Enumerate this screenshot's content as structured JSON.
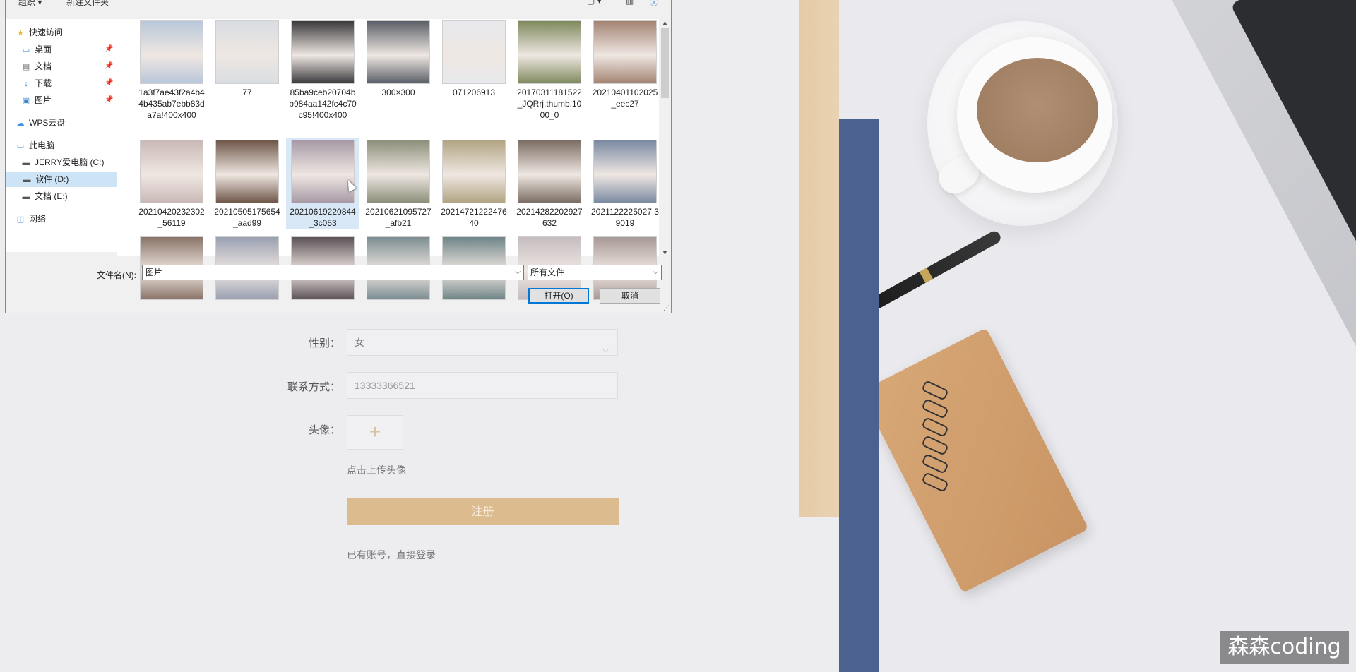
{
  "dialog": {
    "toolbar": {
      "organize": "组织 ▾",
      "new_folder": "新建文件夹"
    },
    "nav": [
      {
        "label": "快速访问",
        "icon": "star-icon",
        "pinned": false
      },
      {
        "label": "桌面",
        "icon": "desktop-icon",
        "pinned": true
      },
      {
        "label": "文档",
        "icon": "document-icon",
        "pinned": true
      },
      {
        "label": "下载",
        "icon": "download-icon",
        "pinned": true
      },
      {
        "label": "图片",
        "icon": "pictures-icon",
        "pinned": true
      },
      {
        "label": "WPS云盘",
        "icon": "cloud-icon",
        "pinned": false
      },
      {
        "label": "此电脑",
        "icon": "computer-icon",
        "pinned": false
      },
      {
        "label": "JERRY爱电脑 (C:)",
        "icon": "drive-icon",
        "pinned": false
      },
      {
        "label": "软件 (D:)",
        "icon": "drive-icon",
        "pinned": false,
        "selected": true
      },
      {
        "label": "文档 (E:)",
        "icon": "drive-icon",
        "pinned": false
      },
      {
        "label": "网络",
        "icon": "network-icon",
        "pinned": false
      }
    ],
    "files": [
      {
        "name": "1a3f7ae43f2a4b44b435ab7ebb83da7a!400x400",
        "color": "#b9c7d9"
      },
      {
        "name": "77",
        "color": "#d9dde2"
      },
      {
        "name": "85ba9ceb20704bb984aa142fc4c70c95!400x400",
        "color": "#3b3a3d"
      },
      {
        "name": "300×300",
        "color": "#5b5f68"
      },
      {
        "name": "071206913",
        "color": "#e7e9ec"
      },
      {
        "name": "20170311181522_JQRrj.thumb.1000_0",
        "color": "#7f8a5e"
      },
      {
        "name": "20210401102025_eec27",
        "color": "#a38473"
      },
      {
        "name": "20210420232302_56119",
        "color": "#c9b9b7"
      },
      {
        "name": "20210505175654_aad99",
        "color": "#6f5749"
      },
      {
        "name": "20210619220844_3c053",
        "color": "#a79aa6",
        "selected": true
      },
      {
        "name": "20210621095727_afb21",
        "color": "#8c8f7a"
      },
      {
        "name": "2021472122247640",
        "color": "#b2a583"
      },
      {
        "name": "20214282202927632",
        "color": "#7c6e64"
      },
      {
        "name": "2021122225027 39019",
        "color": "#7b8aa2"
      },
      {
        "name": "",
        "color": "#8a7468"
      },
      {
        "name": "",
        "color": "#9aa0b2"
      },
      {
        "name": "",
        "color": "#5c5258"
      },
      {
        "name": "",
        "color": "#7d8d92"
      },
      {
        "name": "",
        "color": "#6f8587"
      },
      {
        "name": "",
        "color": "#c5bcc0"
      },
      {
        "name": "",
        "color": "#a89996"
      }
    ],
    "filename_label": "文件名(N):",
    "filename_value": "图片",
    "filetype_value": "所有文件",
    "open_label": "打开(O)",
    "cancel_label": "取消"
  },
  "form": {
    "gender_label": "性别：",
    "gender_value": "女",
    "contact_label": "联系方式：",
    "contact_placeholder": "13333366521",
    "avatar_label": "头像：",
    "avatar_plus": "+",
    "upload_hint": "点击上传头像",
    "register_label": "注册",
    "login_link": "已有账号，直接登录"
  },
  "watermark": "森森coding"
}
